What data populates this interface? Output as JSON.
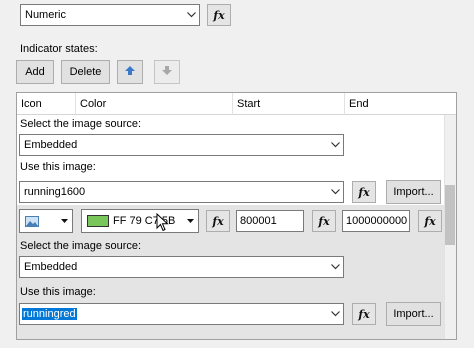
{
  "top": {
    "display_combo": {
      "value": "Numeric"
    }
  },
  "indicator": {
    "label": "Indicator states:",
    "add_label": "Add",
    "delete_label": "Delete"
  },
  "grid": {
    "columns": [
      "Icon",
      "Color",
      "Start",
      "End"
    ],
    "rows": [
      {
        "image_source_label": "Select the image source:",
        "image_source_value": "Embedded",
        "use_image_label": "Use this image:",
        "image_value": "running1600",
        "import_label": "Import..."
      },
      {
        "color_text": "FF 79 C7 5B",
        "start_value": "800001",
        "end_value": "1000000000",
        "image_source_label": "Select the image source:",
        "image_source_value": "Embedded",
        "use_image_label": "Use this image:",
        "image_value": "runningred",
        "import_label": "Import..."
      }
    ]
  },
  "fx_label": "fx",
  "colors": {
    "swatch": "#79c75b",
    "selection": "#0078d7"
  },
  "icons": {
    "move_up": "up-arrow-icon",
    "move_down": "down-arrow-icon",
    "image_picker": "image-icon"
  }
}
